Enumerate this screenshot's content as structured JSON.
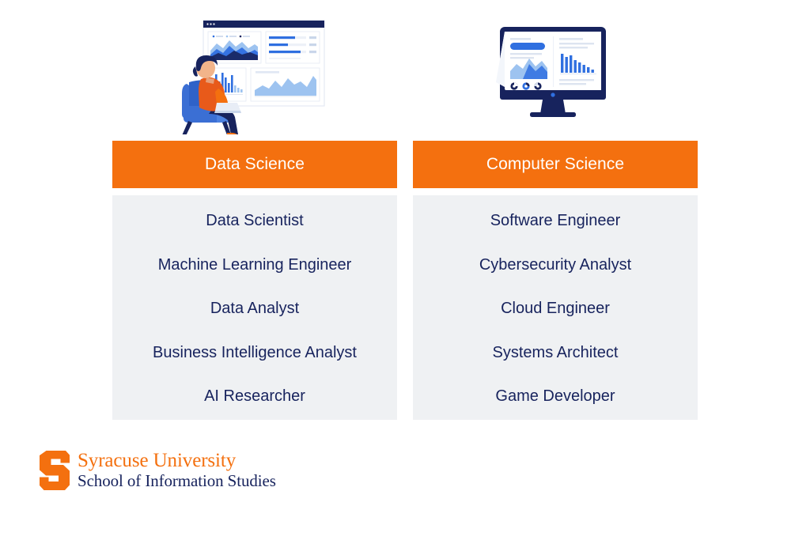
{
  "theme": {
    "orange": "#F4700F",
    "navy": "#17235D",
    "panel_gray": "#EFF1F3",
    "white": "#FFFFFF",
    "chart_blue": "#2F6FE0",
    "chart_light_blue": "#9DC3F0"
  },
  "columns": [
    {
      "id": "data-science",
      "header": "Data Science",
      "illustration": "person-at-dashboard-illustration",
      "items": [
        "Data Scientist",
        "Machine Learning Engineer",
        "Data Analyst",
        "Business Intelligence Analyst",
        "AI Researcher"
      ]
    },
    {
      "id": "computer-science",
      "header": "Computer Science",
      "illustration": "desktop-monitor-dashboard-illustration",
      "items": [
        "Software Engineer",
        "Cybersecurity Analyst",
        "Cloud Engineer",
        "Systems Architect",
        "Game Developer"
      ]
    }
  ],
  "logo": {
    "mark": "syracuse-block-s-icon",
    "university": "Syracuse University",
    "school": "School of Information Studies"
  }
}
